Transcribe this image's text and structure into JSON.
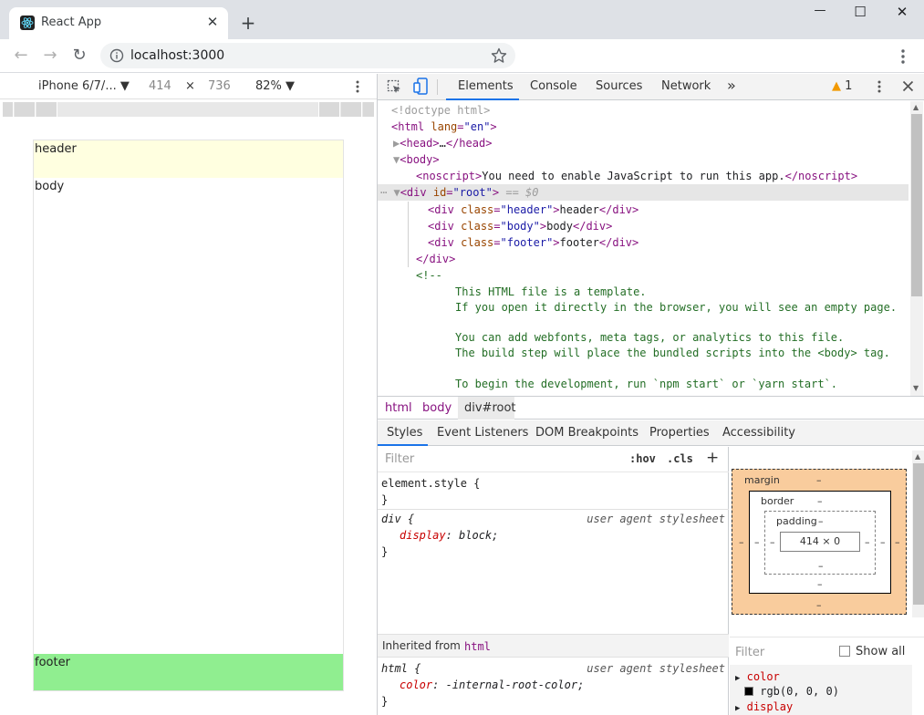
{
  "browser": {
    "tab_title": "React App",
    "tab_close": "✕",
    "new_tab": "+",
    "url": "localhost:3000",
    "window_controls": {
      "minimize": "—",
      "maximize": "☐",
      "close": "✕"
    },
    "nav": {
      "back": "←",
      "forward": "→",
      "reload": "↻"
    }
  },
  "device_toolbar": {
    "device": "iPhone 6/7/...",
    "width": "414",
    "times": "×",
    "height": "736",
    "zoom": "82%"
  },
  "page": {
    "header": "header",
    "body": "body",
    "footer": "footer",
    "colors": {
      "header_bg": "#ffffe0",
      "footer_bg": "#90ee90"
    }
  },
  "devtools": {
    "tabs": [
      "Elements",
      "Console",
      "Sources",
      "Network"
    ],
    "more_tabs": "»",
    "warnings_count": "1",
    "dom": {
      "doctype": "<!doctype html>",
      "html_open_tag": "html",
      "html_lang_attr": "lang",
      "html_lang_val": "\"en\"",
      "head": "head",
      "head_ellipsis": "…",
      "body": "body",
      "noscript_text": "You need to enable JavaScript to run this app.",
      "root_id": "\"root\"",
      "selected_marker": "== $0",
      "children": [
        {
          "class": "\"header\"",
          "text": "header"
        },
        {
          "class": "\"body\"",
          "text": "body"
        },
        {
          "class": "\"footer\"",
          "text": "footer"
        }
      ],
      "comment_open": "<!--",
      "comment_lines": [
        "This HTML file is a template.",
        "If you open it directly in the browser, you will see an empty page.",
        "",
        "You can add webfonts, meta tags, or analytics to this file.",
        "The build step will place the bundled scripts into the <body> tag.",
        "",
        "To begin the development, run `npm start` or `yarn start`."
      ]
    },
    "breadcrumbs": [
      "html",
      "body",
      "div#root"
    ],
    "style_tabs": [
      "Styles",
      "Event Listeners",
      "DOM Breakpoints",
      "Properties",
      "Accessibility"
    ],
    "styles": {
      "filter_placeholder": "Filter",
      "hov": ":hov",
      "cls": ".cls",
      "add": "+",
      "element_style": "element.style {",
      "close_brace": "}",
      "div_selector": "div {",
      "div_source": "user agent stylesheet",
      "div_prop": "display",
      "div_val": "block;",
      "inherited_label": "Inherited from",
      "inherited_tag": "html",
      "html_selector": "html {",
      "html_source": "user agent stylesheet",
      "html_prop": "color",
      "html_val": "-internal-root-color;"
    },
    "box_model": {
      "margin_label": "margin",
      "border_label": "border",
      "padding_label": "padding",
      "dash": "–",
      "content": "414 × 0"
    },
    "computed": {
      "filter_placeholder": "Filter",
      "show_all": "Show all",
      "props": [
        {
          "name": "color",
          "value": "rgb(0, 0, 0)"
        },
        {
          "name": "display",
          "value": ""
        }
      ]
    }
  }
}
